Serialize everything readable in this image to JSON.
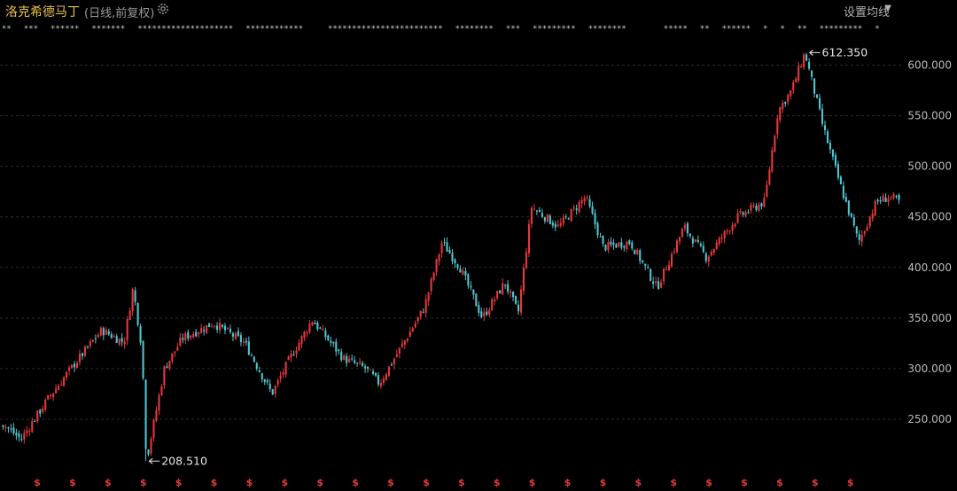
{
  "header": {
    "stock_name": "洛克希德马丁",
    "chart_mode": "(日线,前复权)",
    "settings_icon": "gear-icon",
    "ma_button": "设置均线",
    "ma_caret": "▼"
  },
  "colors": {
    "background": "#000000",
    "up": "#e8383d",
    "down": "#4fc7d1",
    "grid": "#2a2a2a",
    "title": "#e8c24a",
    "dividend_marker": "#e23a3a"
  },
  "chart_data": {
    "type": "candlestick",
    "ylim": [
      200,
      625
    ],
    "yticks": [
      "250.000",
      "300.000",
      "350.000",
      "400.000",
      "450.000",
      "500.000",
      "550.000",
      "600.000"
    ],
    "grid": "horizontal dashed",
    "high_label": "612.350",
    "low_label": "208.510",
    "high_value": 612.35,
    "low_value": 208.51,
    "dividend_marker_symbol": "$",
    "dividend_marker_count": 24,
    "event_marker_symbol": "*",
    "path": [
      [
        0,
        245
      ],
      [
        0.02,
        230
      ],
      [
        0.05,
        270
      ],
      [
        0.08,
        305
      ],
      [
        0.11,
        338
      ],
      [
        0.135,
        326
      ],
      [
        0.145,
        380
      ],
      [
        0.155,
        320
      ],
      [
        0.16,
        208.5
      ],
      [
        0.18,
        300
      ],
      [
        0.2,
        330
      ],
      [
        0.235,
        345
      ],
      [
        0.27,
        325
      ],
      [
        0.3,
        275
      ],
      [
        0.32,
        310
      ],
      [
        0.345,
        348
      ],
      [
        0.38,
        310
      ],
      [
        0.405,
        300
      ],
      [
        0.42,
        285
      ],
      [
        0.45,
        330
      ],
      [
        0.47,
        360
      ],
      [
        0.49,
        425
      ],
      [
        0.51,
        400
      ],
      [
        0.535,
        350
      ],
      [
        0.56,
        385
      ],
      [
        0.575,
        355
      ],
      [
        0.59,
        460
      ],
      [
        0.62,
        440
      ],
      [
        0.65,
        470
      ],
      [
        0.67,
        420
      ],
      [
        0.7,
        425
      ],
      [
        0.73,
        380
      ],
      [
        0.76,
        440
      ],
      [
        0.785,
        410
      ],
      [
        0.82,
        450
      ],
      [
        0.85,
        465
      ],
      [
        0.865,
        555
      ],
      [
        0.88,
        575
      ],
      [
        0.895,
        612.35
      ],
      [
        0.915,
        540
      ],
      [
        0.935,
        480
      ],
      [
        0.955,
        425
      ],
      [
        0.975,
        465
      ],
      [
        0.99,
        470
      ],
      [
        1,
        465
      ]
    ]
  }
}
